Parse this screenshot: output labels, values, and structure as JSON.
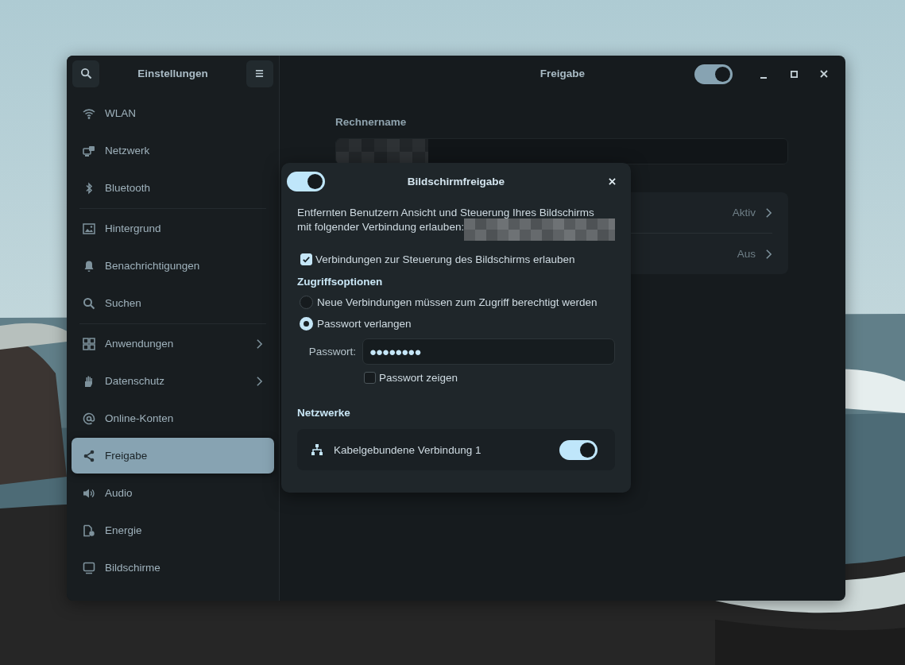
{
  "sidebar": {
    "title": "Einstellungen",
    "groups": [
      [
        {
          "label": "WLAN",
          "selected": false,
          "has_submenu": false
        },
        {
          "label": "Netzwerk",
          "selected": false,
          "has_submenu": false
        },
        {
          "label": "Bluetooth",
          "selected": false,
          "has_submenu": false
        }
      ],
      [
        {
          "label": "Hintergrund",
          "selected": false,
          "has_submenu": false
        },
        {
          "label": "Benachrichtigungen",
          "selected": false,
          "has_submenu": false
        },
        {
          "label": "Suchen",
          "selected": false,
          "has_submenu": false
        }
      ],
      [
        {
          "label": "Anwendungen",
          "selected": false,
          "has_submenu": true
        },
        {
          "label": "Datenschutz",
          "selected": false,
          "has_submenu": true
        },
        {
          "label": "Online-Konten",
          "selected": false,
          "has_submenu": false
        },
        {
          "label": "Freigabe",
          "selected": true,
          "has_submenu": false
        },
        {
          "label": "Audio",
          "selected": false,
          "has_submenu": false
        },
        {
          "label": "Energie",
          "selected": false,
          "has_submenu": false
        },
        {
          "label": "Bildschirme",
          "selected": false,
          "has_submenu": false
        }
      ]
    ]
  },
  "main": {
    "title": "Freigabe",
    "sharing_on": true,
    "hostname_label": "Rechnername",
    "services": [
      {
        "status": "Aktiv"
      },
      {
        "status": "Aus"
      }
    ]
  },
  "dialog": {
    "title": "Bildschirmfreigabe",
    "on": true,
    "description_lines": [
      "Entfernten Benutzern Ansicht und Steuerung Ihres Bildschirms",
      "mit folgender Verbindung erlauben:"
    ],
    "allow_control": {
      "label": "Verbindungen zur Steuerung des Bildschirms erlauben",
      "checked": true
    },
    "access_heading": "Zugriffsoptionen",
    "access_options": [
      {
        "label": "Neue Verbindungen müssen zum Zugriff berechtigt werden",
        "selected": false
      },
      {
        "label": "Passwort verlangen",
        "selected": true
      }
    ],
    "password_label": "Passwort:",
    "password_value": "●●●●●●●●",
    "show_password": {
      "label": "Passwort zeigen",
      "checked": false
    },
    "networks_heading": "Netzwerke",
    "networks": [
      {
        "name": "Kabelgebundene Verbindung 1",
        "on": true
      }
    ]
  }
}
